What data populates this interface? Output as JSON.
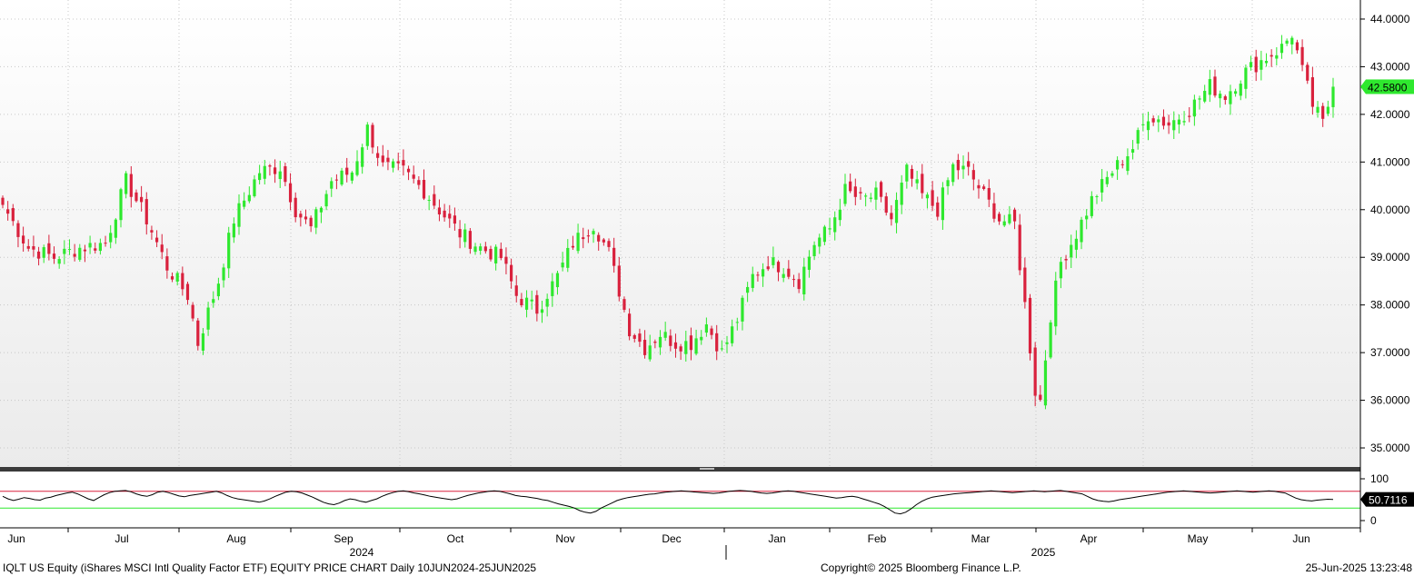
{
  "chart_data": {
    "type": "candlestick",
    "ticker": "IQLT US Equity",
    "period": "Daily",
    "price_axis": {
      "ylim": [
        34.6,
        44.4
      ],
      "ticks": [
        "35.0000",
        "36.0000",
        "37.0000",
        "38.0000",
        "39.0000",
        "40.0000",
        "41.0000",
        "42.0000",
        "43.0000",
        "44.0000"
      ]
    },
    "last_price": "42.5800",
    "month_labels": [
      "Jun",
      "Jul",
      "Aug",
      "Sep",
      "Oct",
      "Nov",
      "Dec",
      "Jan",
      "Feb",
      "Mar",
      "Apr",
      "May",
      "Jun"
    ],
    "year_labels": [
      "2024",
      "2025"
    ],
    "anchors": [
      {
        "i": 0,
        "v": 40.1
      },
      {
        "i": 5,
        "v": 39.2
      },
      {
        "i": 10,
        "v": 39.0
      },
      {
        "i": 15,
        "v": 39.2
      },
      {
        "i": 20,
        "v": 39.3
      },
      {
        "i": 24,
        "v": 40.6
      },
      {
        "i": 28,
        "v": 39.8
      },
      {
        "i": 32,
        "v": 38.8
      },
      {
        "i": 36,
        "v": 38.2
      },
      {
        "i": 38,
        "v": 37.2
      },
      {
        "i": 42,
        "v": 38.5
      },
      {
        "i": 45,
        "v": 39.8
      },
      {
        "i": 50,
        "v": 40.8
      },
      {
        "i": 54,
        "v": 40.9
      },
      {
        "i": 57,
        "v": 40.0
      },
      {
        "i": 60,
        "v": 39.6
      },
      {
        "i": 64,
        "v": 40.6
      },
      {
        "i": 68,
        "v": 40.8
      },
      {
        "i": 71,
        "v": 41.7
      },
      {
        "i": 74,
        "v": 40.9
      },
      {
        "i": 78,
        "v": 40.8
      },
      {
        "i": 82,
        "v": 40.4
      },
      {
        "i": 85,
        "v": 40.0
      },
      {
        "i": 89,
        "v": 39.5
      },
      {
        "i": 93,
        "v": 39.2
      },
      {
        "i": 97,
        "v": 39.0
      },
      {
        "i": 100,
        "v": 38.2
      },
      {
        "i": 104,
        "v": 37.9
      },
      {
        "i": 108,
        "v": 38.6
      },
      {
        "i": 111,
        "v": 39.3
      },
      {
        "i": 115,
        "v": 39.7
      },
      {
        "i": 118,
        "v": 39.1
      },
      {
        "i": 122,
        "v": 37.5
      },
      {
        "i": 125,
        "v": 37.1
      },
      {
        "i": 128,
        "v": 37.4
      },
      {
        "i": 131,
        "v": 37.2
      },
      {
        "i": 134,
        "v": 37.2
      },
      {
        "i": 137,
        "v": 37.6
      },
      {
        "i": 140,
        "v": 37.0
      },
      {
        "i": 143,
        "v": 37.7
      },
      {
        "i": 146,
        "v": 38.6
      },
      {
        "i": 149,
        "v": 38.9
      },
      {
        "i": 152,
        "v": 38.8
      },
      {
        "i": 155,
        "v": 38.5
      },
      {
        "i": 158,
        "v": 39.3
      },
      {
        "i": 161,
        "v": 39.6
      },
      {
        "i": 164,
        "v": 40.4
      },
      {
        "i": 167,
        "v": 40.2
      },
      {
        "i": 170,
        "v": 40.3
      },
      {
        "i": 173,
        "v": 39.8
      },
      {
        "i": 176,
        "v": 40.8
      },
      {
        "i": 179,
        "v": 40.3
      },
      {
        "i": 182,
        "v": 40.0
      },
      {
        "i": 185,
        "v": 40.9
      },
      {
        "i": 188,
        "v": 40.8
      },
      {
        "i": 191,
        "v": 40.3
      },
      {
        "i": 194,
        "v": 39.8
      },
      {
        "i": 197,
        "v": 39.7
      },
      {
        "i": 199,
        "v": 38.0
      },
      {
        "i": 201,
        "v": 36.2
      },
      {
        "i": 202,
        "v": 36.0
      },
      {
        "i": 204,
        "v": 37.8
      },
      {
        "i": 206,
        "v": 38.9
      },
      {
        "i": 209,
        "v": 39.5
      },
      {
        "i": 212,
        "v": 40.2
      },
      {
        "i": 216,
        "v": 40.8
      },
      {
        "i": 220,
        "v": 41.3
      },
      {
        "i": 223,
        "v": 42.0
      },
      {
        "i": 227,
        "v": 41.8
      },
      {
        "i": 231,
        "v": 42.1
      },
      {
        "i": 235,
        "v": 42.6
      },
      {
        "i": 238,
        "v": 42.4
      },
      {
        "i": 242,
        "v": 42.9
      },
      {
        "i": 246,
        "v": 43.2
      },
      {
        "i": 249,
        "v": 43.4
      },
      {
        "i": 251,
        "v": 43.7
      },
      {
        "i": 253,
        "v": 42.9
      },
      {
        "i": 255,
        "v": 42.2
      },
      {
        "i": 257,
        "v": 41.8
      },
      {
        "i": 259,
        "v": 42.58
      }
    ],
    "indicator": {
      "ylim": [
        0,
        100
      ],
      "ticks": [
        "100",
        "0"
      ],
      "upper": 70,
      "lower": 30,
      "last_value": "50.7116",
      "values": [
        58,
        52,
        48,
        51,
        55,
        53,
        50,
        49,
        54,
        56,
        60,
        63,
        66,
        68,
        64,
        58,
        52,
        48,
        55,
        62,
        67,
        70,
        71,
        72,
        69,
        64,
        60,
        58,
        62,
        68,
        70,
        67,
        63,
        59,
        57,
        60,
        62,
        64,
        66,
        68,
        70,
        66,
        60,
        55,
        52,
        50,
        48,
        46,
        44,
        47,
        52,
        58,
        63,
        68,
        70,
        69,
        66,
        61,
        56,
        50,
        44,
        40,
        38,
        42,
        48,
        52,
        50,
        46,
        44,
        48,
        52,
        58,
        63,
        67,
        70,
        71,
        69,
        66,
        64,
        61,
        58,
        56,
        54,
        52,
        50,
        52,
        56,
        60,
        63,
        66,
        68,
        70,
        71,
        70,
        67,
        64,
        60,
        58,
        57,
        55,
        53,
        50,
        48,
        44,
        40,
        37,
        34,
        30,
        24,
        20,
        18,
        22,
        30,
        36,
        42,
        48,
        52,
        55,
        57,
        59,
        61,
        63,
        64,
        66,
        68,
        69,
        70,
        71,
        70,
        69,
        68,
        67,
        66,
        65,
        66,
        68,
        70,
        71,
        72,
        71,
        70,
        68,
        66,
        65,
        66,
        68,
        70,
        71,
        70,
        68,
        66,
        64,
        62,
        60,
        58,
        56,
        54,
        55,
        57,
        58,
        56,
        52,
        48,
        44,
        40,
        34,
        26,
        18,
        16,
        20,
        28,
        38,
        46,
        52,
        56,
        58,
        60,
        62,
        64,
        65,
        66,
        67,
        68,
        69,
        70,
        71,
        70,
        69,
        68,
        67,
        68,
        69,
        70,
        71,
        70,
        69,
        70,
        71,
        72,
        70,
        68,
        66,
        64,
        58,
        52,
        48,
        46,
        45,
        47,
        50,
        52,
        54,
        56,
        58,
        60,
        62,
        64,
        66,
        68,
        69,
        70,
        71,
        70,
        69,
        68,
        67,
        66,
        67,
        68,
        69,
        70,
        71,
        70,
        69,
        68,
        69,
        70,
        71,
        70,
        68,
        66,
        60,
        54,
        50,
        48,
        47,
        49,
        50,
        51,
        50.7
      ]
    },
    "footer": {
      "left": "IQLT US Equity (iShares MSCI Intl Quality Factor ETF) EQUITY PRICE CHART  Daily 10JUN2024-25JUN2025",
      "center": "Copyright© 2025 Bloomberg Finance L.P.",
      "right": "25-Jun-2025 13:23:48"
    },
    "colors": {
      "up": "#2ee82e",
      "down": "#d9213d",
      "overbought": "#d9213d",
      "oversold": "#2ee82e",
      "last_price_bg": "#2ee82e"
    }
  }
}
